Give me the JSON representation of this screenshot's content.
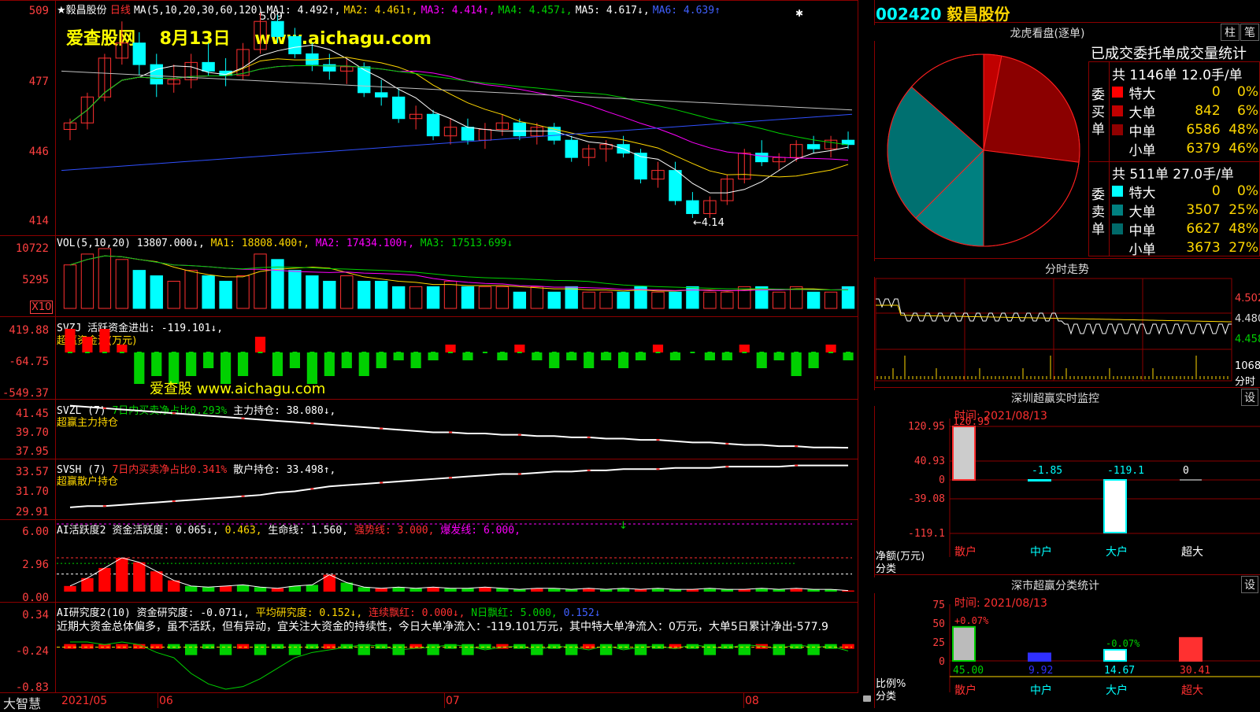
{
  "header": {
    "star": "★",
    "stock_name": "毅昌股份",
    "period": "日线",
    "ma_label": "MA(5,10,20,30,60,120)",
    "ma1": "MA1: 4.492↑,",
    "ma2": "MA2: 4.461↑,",
    "ma3": "MA3: 4.414↑,",
    "ma4": "MA4: 4.457↓,",
    "ma5": "MA5: 4.617↓,",
    "ma6": "MA6: 4.639↑",
    "watermark": "爱查股网    8月13日    www.aichagu.com",
    "high_mark": "5.09",
    "low_mark": "←4.14"
  },
  "price_axis": [
    "509",
    "477",
    "446",
    "414"
  ],
  "vol": {
    "label": "VOL(5,10,20)",
    "value": "13807.000↓,",
    "ma1": "MA1: 18808.400↑,",
    "ma2": "MA2: 17434.100↑,",
    "ma3": "MA3: 17513.699↓",
    "axis": [
      "10722",
      "5295"
    ],
    "x10": "X10"
  },
  "svzj": {
    "label": "SVZJ  活跃资金进出: -119.101↓,",
    "sub": "超赢资金流(万元)",
    "axis": [
      "419.88",
      "-64.75",
      "-549.37"
    ],
    "watermark": "爱查股 www.aichagu.com"
  },
  "svzl": {
    "label": "SVZL (7)",
    "ratio": "7日内买卖净占比0.293%",
    "hold": "主力持仓: 38.080↓,",
    "sub": "超赢主力持仓",
    "axis": [
      "41.45",
      "39.70",
      "37.95"
    ]
  },
  "svsh": {
    "label": "SVSH (7)",
    "ratio": "7日内买卖净占比0.341%",
    "hold": "散户持仓: 33.498↑,",
    "sub": "超赢散户持仓",
    "axis": [
      "33.57",
      "31.70",
      "29.91"
    ]
  },
  "ai_active": {
    "label": "AI活跃度2",
    "t1": "资金活跃度: 0.065↓,",
    "t2": "0.463,",
    "t3": "生命线: 1.560,",
    "t4": "强势线: 3.000,",
    "t5": "爆发线: 6.000,",
    "arrow": "↓",
    "axis": [
      "6.00",
      "2.96",
      "0.00"
    ]
  },
  "ai_research": {
    "label": "AI研究度2(10)",
    "t1": "资金研究度: -0.071↓,",
    "t2": "平均研究度: 0.152↓,",
    "t3": "连续飘红: 0.000↓,",
    "t4": "N日飘红: 5.000,",
    "t5": "0.152↓",
    "comment": "近期大资金总体偏多，虽不活跃，但有异动，宜关注大资金的持续性，今日大单净流入：-119.101万元，其中特大单净流入：0万元，大单5日累计净出-577.9",
    "axis": [
      "0.34",
      "-0.24",
      "-0.83"
    ]
  },
  "bottom_bar": {
    "brand": "大智慧",
    "dates": [
      "2021/05",
      "06",
      "07",
      "08"
    ]
  },
  "right": {
    "code": "002420",
    "name": "毅昌股份",
    "dragon_title": "龙虎看盘(逐单)",
    "btn1": "柱",
    "btn2": "笔",
    "stat_title": "已成交委托单成交量统计",
    "buy": {
      "side": "委买单",
      "total": "共 1146单 12.0手/单",
      "rows": [
        {
          "name": "特大",
          "qty": "0",
          "pct": "0%",
          "color": "#ff0000"
        },
        {
          "name": "大单",
          "qty": "842",
          "pct": "6%",
          "color": "#c00000"
        },
        {
          "name": "中单",
          "qty": "6586",
          "pct": "48%",
          "color": "#900000"
        },
        {
          "name": "小单",
          "qty": "6379",
          "pct": "46%",
          "color": "#000000"
        }
      ]
    },
    "sell": {
      "side": "委卖单",
      "total": "共 511单 27.0手/单",
      "rows": [
        {
          "name": "特大",
          "qty": "0",
          "pct": "0%",
          "color": "#00ffff"
        },
        {
          "name": "大单",
          "qty": "3507",
          "pct": "25%",
          "color": "#008080"
        },
        {
          "name": "中单",
          "qty": "6627",
          "pct": "48%",
          "color": "#006a6a"
        },
        {
          "name": "小单",
          "qty": "3673",
          "pct": "27%",
          "color": "#000000"
        }
      ]
    },
    "intraday_title": "分时走势",
    "intraday_axis": [
      "4.502",
      "4.480",
      "4.458"
    ],
    "intraday_vol": "1068",
    "intraday_vol_lbl": "分时",
    "sz_title": "深圳超赢实时监控",
    "set": "设",
    "sz_time": "时间: 2021/08/13",
    "sz_axis": [
      "120.95",
      "40.93",
      "0",
      "-39.08",
      "-119.1"
    ],
    "sz_vals": [
      {
        "cat": "散户",
        "val": "120.95",
        "v": 120.95
      },
      {
        "cat": "中户",
        "val": "-1.85",
        "v": -1.85
      },
      {
        "cat": "大户",
        "val": "-119.1",
        "v": -119.1
      },
      {
        "cat": "超大",
        "val": "0",
        "v": 0
      }
    ],
    "sz_unit": "净额(万元)",
    "sz_class": "分类",
    "cls_title": "深市超赢分类统计",
    "cls_time": "时间: 2021/08/13",
    "cls_axis": [
      "75",
      "50",
      "25",
      "0"
    ],
    "cls_vals": [
      {
        "cat": "散户",
        "val": "45.00",
        "v": 45.0,
        "delta": "+0.07%"
      },
      {
        "cat": "中户",
        "val": "9.92",
        "v": 9.92,
        "delta": ""
      },
      {
        "cat": "大户",
        "val": "14.67",
        "v": 14.67,
        "delta": "-0.07%"
      },
      {
        "cat": "超大",
        "val": "30.41",
        "v": 30.41,
        "delta": ""
      }
    ],
    "cls_unit": "比例%",
    "cls_class": "分类"
  },
  "chart_data": {
    "type": "candlestick",
    "ohlc": [
      [
        4.55,
        4.6,
        4.5,
        4.58
      ],
      [
        4.58,
        4.72,
        4.55,
        4.7
      ],
      [
        4.7,
        4.9,
        4.68,
        4.88
      ],
      [
        4.88,
        5.05,
        4.85,
        4.95
      ],
      [
        4.95,
        5.0,
        4.8,
        4.85
      ],
      [
        4.85,
        4.9,
        4.7,
        4.76
      ],
      [
        4.76,
        4.85,
        4.72,
        4.78
      ],
      [
        4.78,
        4.9,
        4.74,
        4.86
      ],
      [
        4.86,
        4.95,
        4.8,
        4.82
      ],
      [
        4.82,
        4.88,
        4.75,
        4.8
      ],
      [
        4.8,
        4.95,
        4.78,
        4.92
      ],
      [
        4.92,
        5.09,
        4.9,
        5.05
      ],
      [
        5.05,
        5.08,
        4.95,
        4.98
      ],
      [
        4.98,
        5.02,
        4.88,
        4.9
      ],
      [
        4.9,
        4.95,
        4.82,
        4.85
      ],
      [
        4.85,
        4.9,
        4.78,
        4.82
      ],
      [
        4.82,
        4.88,
        4.76,
        4.84
      ],
      [
        4.84,
        4.86,
        4.7,
        4.72
      ],
      [
        4.72,
        4.78,
        4.66,
        4.7
      ],
      [
        4.7,
        4.74,
        4.58,
        4.6
      ],
      [
        4.6,
        4.66,
        4.55,
        4.62
      ],
      [
        4.62,
        4.64,
        4.5,
        4.52
      ],
      [
        4.52,
        4.6,
        4.48,
        4.56
      ],
      [
        4.56,
        4.6,
        4.48,
        4.5
      ],
      [
        4.5,
        4.58,
        4.46,
        4.55
      ],
      [
        4.55,
        4.62,
        4.52,
        4.58
      ],
      [
        4.58,
        4.6,
        4.5,
        4.52
      ],
      [
        4.52,
        4.58,
        4.48,
        4.56
      ],
      [
        4.56,
        4.58,
        4.48,
        4.5
      ],
      [
        4.5,
        4.52,
        4.4,
        4.42
      ],
      [
        4.42,
        4.48,
        4.38,
        4.46
      ],
      [
        4.46,
        4.5,
        4.4,
        4.48
      ],
      [
        4.48,
        4.52,
        4.42,
        4.44
      ],
      [
        4.44,
        4.46,
        4.3,
        4.32
      ],
      [
        4.32,
        4.4,
        4.28,
        4.36
      ],
      [
        4.36,
        4.4,
        4.2,
        4.22
      ],
      [
        4.22,
        4.26,
        4.14,
        4.16
      ],
      [
        4.16,
        4.24,
        4.14,
        4.22
      ],
      [
        4.22,
        4.34,
        4.2,
        4.32
      ],
      [
        4.32,
        4.46,
        4.3,
        4.44
      ],
      [
        4.44,
        4.5,
        4.38,
        4.4
      ],
      [
        4.4,
        4.44,
        4.36,
        4.42
      ],
      [
        4.42,
        4.5,
        4.4,
        4.48
      ],
      [
        4.48,
        4.52,
        4.44,
        4.46
      ],
      [
        4.46,
        4.52,
        4.42,
        4.5
      ],
      [
        4.5,
        4.54,
        4.46,
        4.48
      ]
    ],
    "volumes": [
      8,
      10,
      11,
      9,
      7,
      6,
      5,
      7,
      6,
      5,
      6,
      10,
      9,
      7,
      6,
      5,
      6,
      5,
      5,
      4,
      4,
      4,
      5,
      4,
      4,
      4,
      3,
      4,
      3,
      4,
      3,
      3,
      3,
      4,
      3,
      3,
      4,
      3,
      3,
      4,
      4,
      3,
      4,
      3,
      3,
      4
    ],
    "svzj": [
      3,
      2,
      3,
      1,
      -4,
      -3,
      -4,
      -3,
      -2,
      -4,
      -3,
      2,
      -3,
      -2,
      -4,
      -3,
      -2,
      -3,
      -2,
      -1,
      -2,
      -1,
      1,
      -1,
      0,
      -1,
      1,
      -1,
      -2,
      -1,
      -2,
      -1,
      -2,
      -1,
      1,
      -1,
      0,
      -1,
      -1,
      1,
      -2,
      -1,
      -3,
      -2,
      1,
      -1
    ],
    "svzl": [
      41.4,
      41.3,
      41.2,
      41.1,
      41.0,
      40.9,
      40.8,
      40.7,
      40.6,
      40.5,
      40.4,
      40.3,
      40.2,
      40.1,
      40.0,
      39.9,
      39.8,
      39.7,
      39.6,
      39.5,
      39.4,
      39.3,
      39.3,
      39.2,
      39.2,
      39.1,
      39.1,
      39.0,
      39.0,
      38.9,
      38.9,
      38.8,
      38.8,
      38.7,
      38.7,
      38.6,
      38.5,
      38.5,
      38.4,
      38.3,
      38.3,
      38.2,
      38.2,
      38.1,
      38.1,
      38.08
    ],
    "svsh": [
      30.1,
      30.2,
      30.2,
      30.3,
      30.4,
      30.5,
      30.6,
      30.7,
      30.8,
      30.9,
      31.0,
      31.1,
      31.3,
      31.4,
      31.6,
      31.8,
      31.9,
      32.0,
      32.1,
      32.2,
      32.3,
      32.4,
      32.5,
      32.6,
      32.7,
      32.8,
      32.8,
      32.9,
      33.0,
      33.0,
      33.1,
      33.1,
      33.2,
      33.2,
      33.2,
      33.3,
      33.3,
      33.3,
      33.4,
      33.4,
      33.4,
      33.4,
      33.5,
      33.5,
      33.5,
      33.5
    ],
    "ai_active": [
      0.5,
      1.2,
      2.1,
      3.0,
      2.6,
      1.8,
      1.0,
      0.5,
      0.4,
      0.5,
      0.6,
      0.4,
      0.3,
      0.5,
      0.6,
      1.5,
      0.8,
      0.4,
      0.3,
      0.4,
      0.3,
      0.4,
      0.3,
      0.3,
      0.4,
      0.3,
      0.2,
      0.3,
      0.3,
      0.2,
      0.3,
      0.2,
      0.3,
      0.2,
      0.3,
      0.2,
      0.2,
      0.3,
      0.2,
      0.2,
      0.3,
      0.2,
      0.3,
      0.2,
      0.2,
      0.1
    ],
    "ai_research": [
      0.1,
      0.1,
      0.05,
      0.1,
      0.05,
      -0.1,
      -0.2,
      -0.5,
      -0.7,
      -0.8,
      -0.75,
      -0.6,
      -0.4,
      -0.2,
      -0.1,
      -0.05,
      0.0,
      0.05,
      0.02,
      -0.05,
      -0.02,
      0.0,
      0.05,
      0.02,
      -0.05,
      0.0,
      0.02,
      -0.05,
      0.02,
      0.0,
      -0.05,
      0.03,
      -0.05,
      0.0,
      0.02,
      -0.03,
      0.05,
      0.0,
      -0.02,
      0.05,
      0.02,
      -0.03,
      0.05,
      0.0,
      0.02,
      -0.071
    ]
  }
}
